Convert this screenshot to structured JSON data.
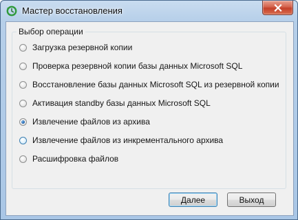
{
  "window": {
    "title": "Мастер восстановления",
    "icon": "restore-wizard-icon",
    "close_icon": "close-icon"
  },
  "group": {
    "title": "Выбор операции",
    "options": [
      {
        "label": "Загрузка резервной копии",
        "checked": false
      },
      {
        "label": "Проверка резервной копии базы данных Microsoft SQL",
        "checked": false
      },
      {
        "label": "Восстановление базы данных Microsoft SQL из резервной копии",
        "checked": false
      },
      {
        "label": "Активация standby базы данных Microsoft SQL",
        "checked": false
      },
      {
        "label": "Извлечение файлов из архива",
        "checked": true
      },
      {
        "label": "Извлечение файлов из инкрементального архива",
        "checked": false
      },
      {
        "label": "Расшифровка файлов",
        "checked": false
      }
    ]
  },
  "buttons": {
    "next": "Далее",
    "exit": "Выход"
  },
  "colors": {
    "frame": "#a9c6e6",
    "close_button": "#c4402a",
    "client": "#f0f0f0"
  }
}
